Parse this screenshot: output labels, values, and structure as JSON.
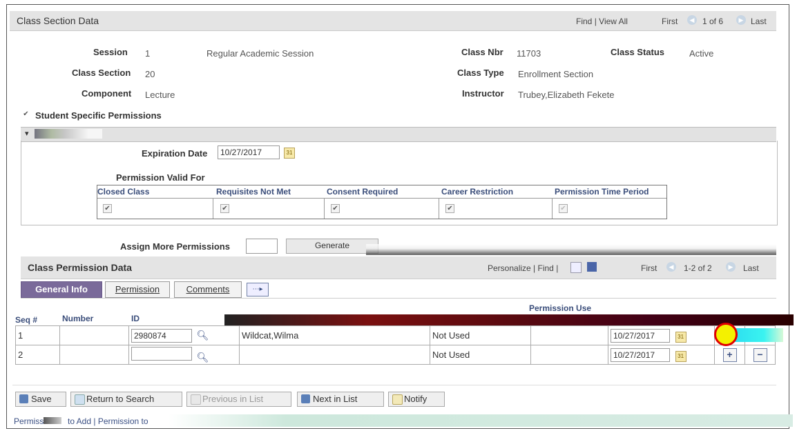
{
  "section": {
    "title": "Class Section Data",
    "find": "Find",
    "view_all": "View All",
    "sep": "|",
    "first": "First",
    "counter": "1 of 6",
    "last": "Last"
  },
  "info": {
    "session_label": "Session",
    "session_value": "1",
    "session_desc": "Regular Academic Session",
    "class_nbr_label": "Class Nbr",
    "class_nbr_value": "11703",
    "class_status_label": "Class Status",
    "class_status_value": "Active",
    "class_section_label": "Class Section",
    "class_section_value": "20",
    "class_type_label": "Class Type",
    "class_type_value": "Enrollment Section",
    "component_label": "Component",
    "component_value": "Lecture",
    "instructor_label": "Instructor",
    "instructor_value": "Trubey,Elizabeth Fekete",
    "student_specific_label": "Student Specific Permissions"
  },
  "defaults": {
    "expiration_label": "Expiration Date",
    "expiration_value": "10/27/2017",
    "permission_valid_for": "Permission Valid For",
    "columns": [
      "Closed Class",
      "Requisites Not Met",
      "Consent Required",
      "Career Restriction",
      "Permission Time Period"
    ]
  },
  "assign": {
    "label": "Assign More Permissions",
    "generate_label": "Generate"
  },
  "permissions": {
    "title": "Class Permission Data",
    "personalize": "Personalize",
    "find": "Find",
    "sep": "|",
    "first": "First",
    "counter": "1-2 of 2",
    "last": "Last",
    "tabs": [
      "General Info",
      "Permission",
      "Comments"
    ],
    "permission_use": "Permission Use",
    "headers": {
      "seq": "Seq #",
      "number": "Number",
      "id": "ID"
    },
    "rows": [
      {
        "seq": "1",
        "id": "2980874",
        "name": "Wildcat,Wilma",
        "status": "Not Used",
        "date": "10/27/2017"
      },
      {
        "seq": "2",
        "id": "",
        "name": "",
        "status": "Not Used",
        "date": "10/27/2017"
      }
    ]
  },
  "footer": {
    "save": "Save",
    "return": "Return to Search",
    "prev": "Previous in List",
    "next": "Next in List",
    "notify": "Notify",
    "link_text": "to Add | Permission to"
  },
  "colors": {
    "accent": "#7a6a9a",
    "highlight": "#e00000"
  }
}
